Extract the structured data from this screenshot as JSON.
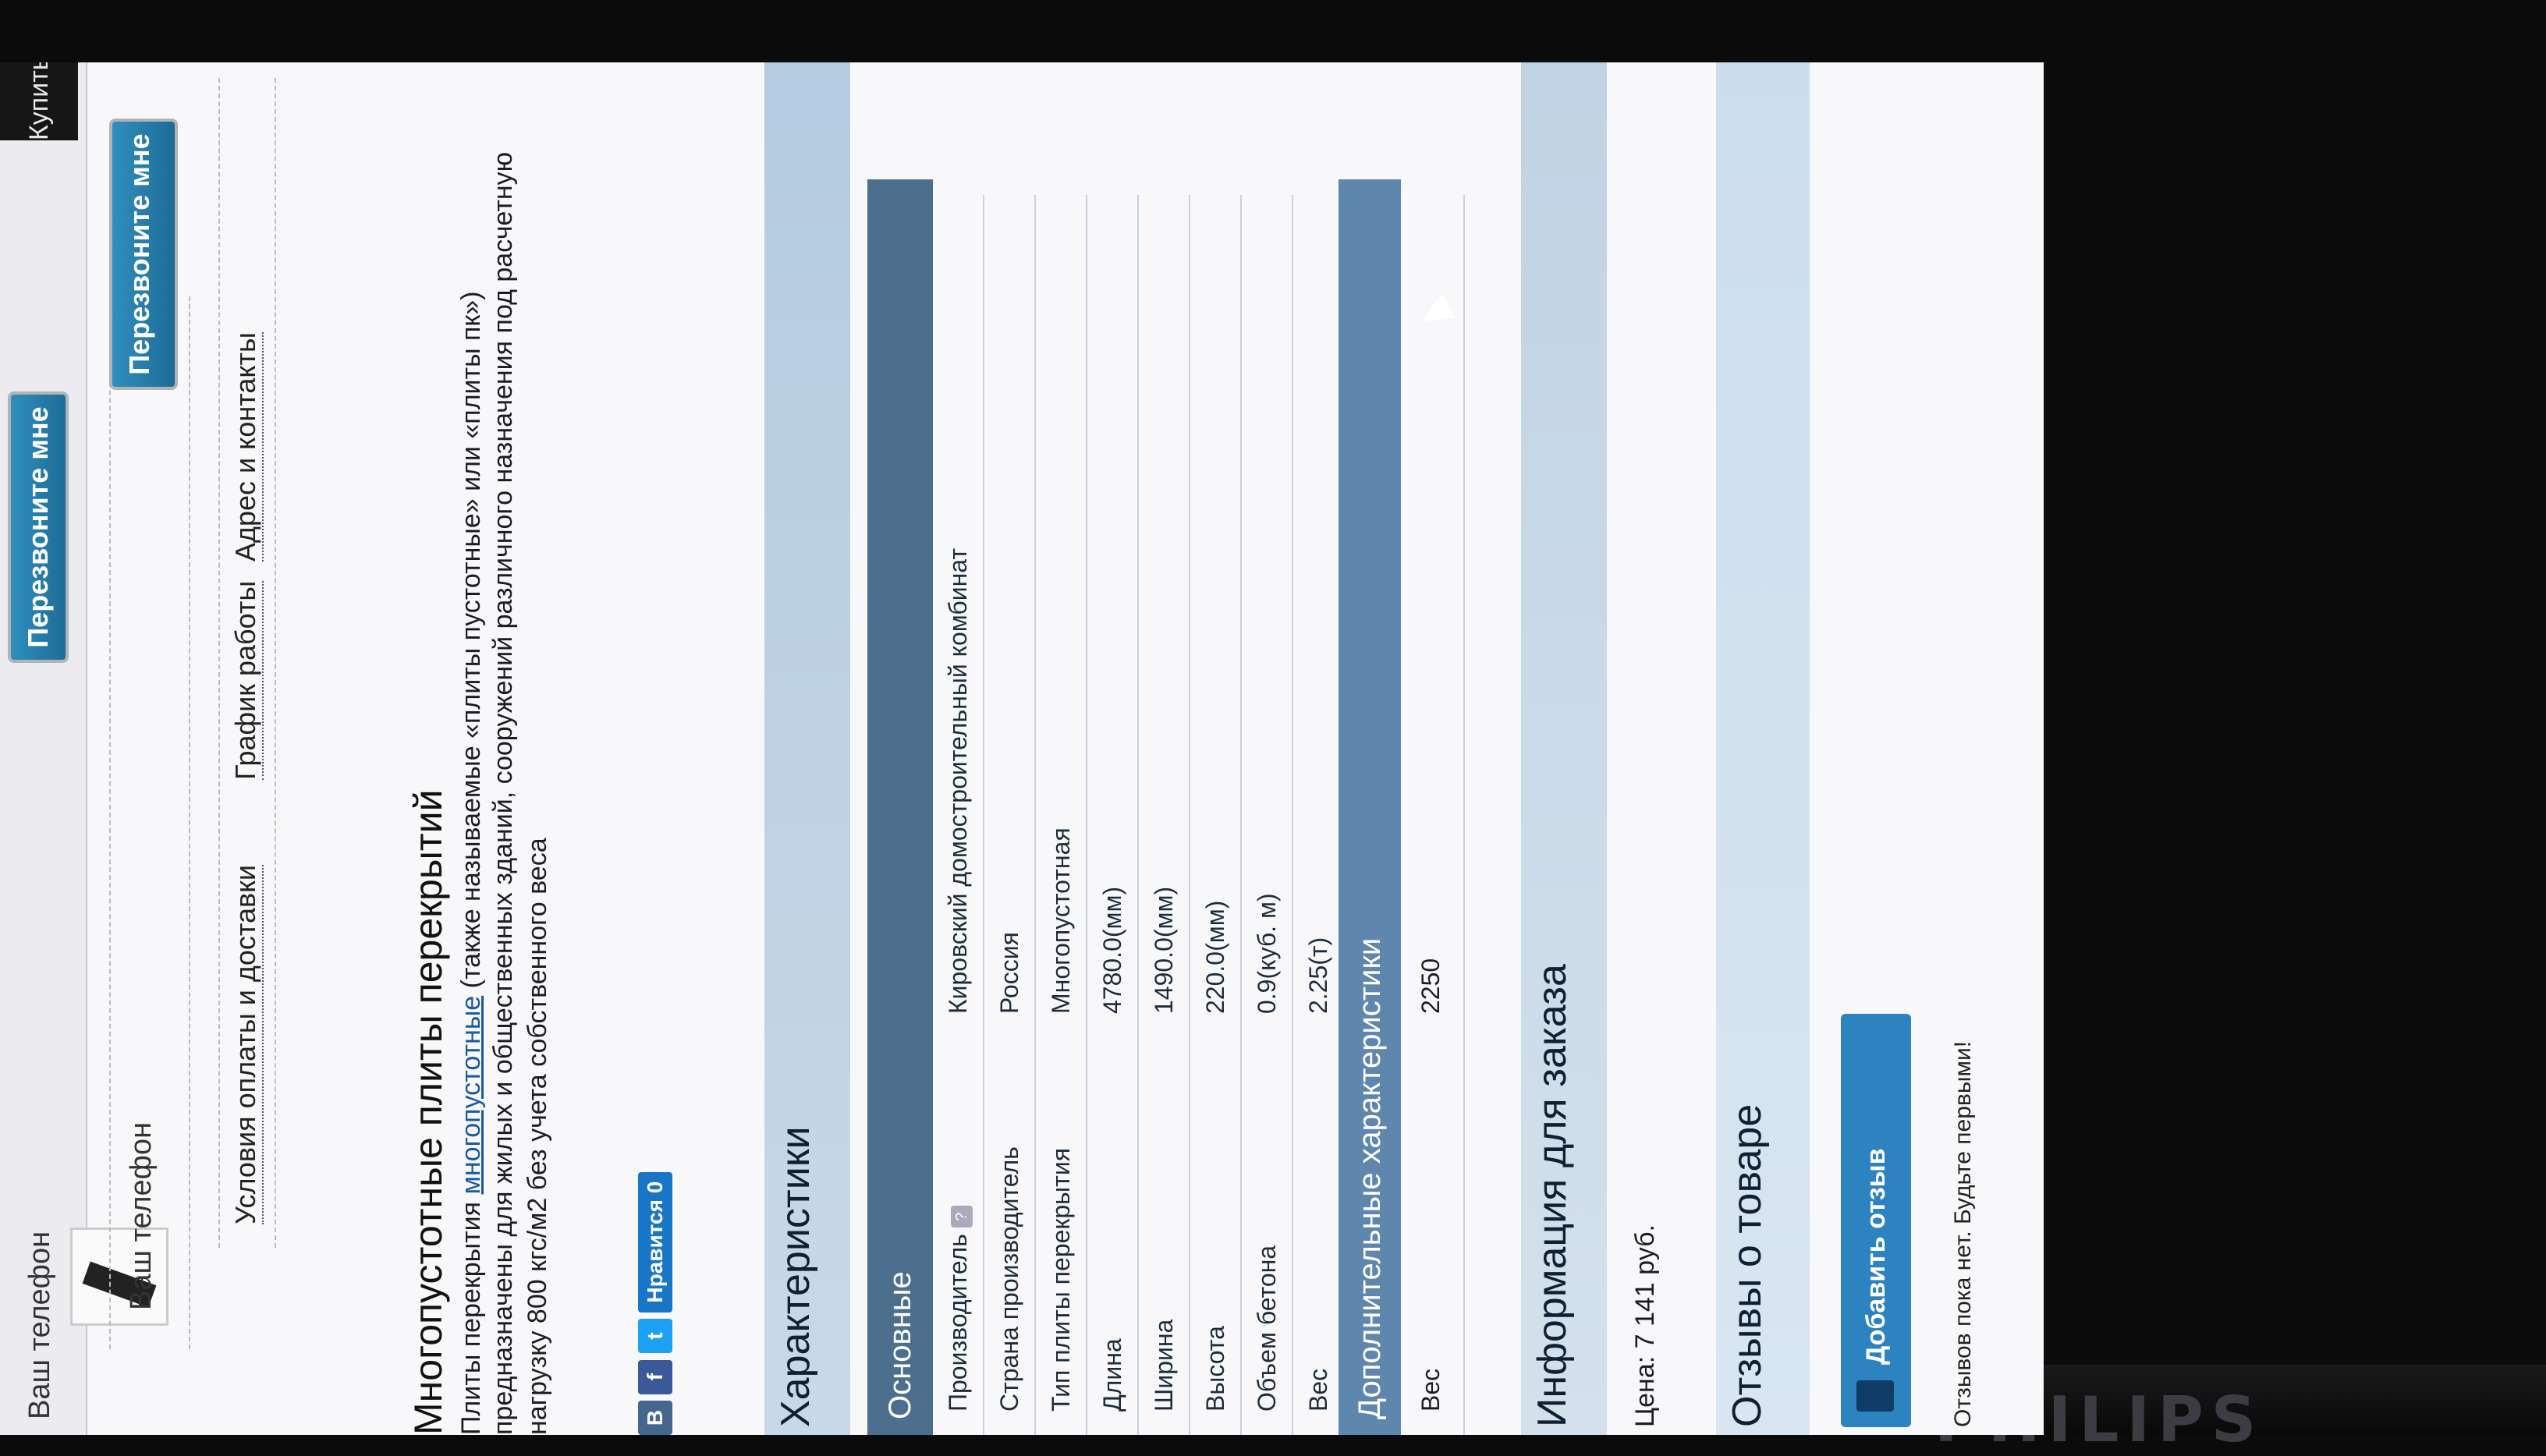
{
  "header": {
    "phone_label_top": "Ваш телефон",
    "call_button_top": "Перезвоните мне",
    "buy_button": "Купить"
  },
  "form": {
    "phone_label": "Ваш телефон",
    "call_button": "Перезвоните мне"
  },
  "links": [
    "Условия оплаты и доставки",
    "График работы",
    "Адрес и контакты"
  ],
  "product": {
    "title": "Многопустотные плиты перекрытий",
    "desc_prefix": "Плиты перекрытия ",
    "desc_link": "многопустотные",
    "desc_rest1": " (также называемые «плиты пустотные» или «плиты пк»)",
    "desc_line2": "предназначены для жилых и общественных зданий, сооружений различного назначения под расчетную",
    "desc_line3": "нагрузку 800 кгс/м2 без учета собственного веса"
  },
  "social": {
    "vk": "В",
    "fb": "f",
    "tw": "t",
    "like": "Нравится 0"
  },
  "characteristics": {
    "title": "Характеристики",
    "basic_header": "Основные",
    "rows": [
      {
        "label": "Производитель",
        "value": "Кировский домостроительный комбинат"
      },
      {
        "label": "Страна производитель",
        "value": "Россия"
      },
      {
        "label": "Тип плиты перекрытия",
        "value": "Многопустотная"
      },
      {
        "label": "Длина",
        "value": "4780.0(мм)"
      },
      {
        "label": "Ширина",
        "value": "1490.0(мм)"
      },
      {
        "label": "Высота",
        "value": "220.0(мм)"
      },
      {
        "label": "Объем бетона",
        "value": "0.9(куб. м)"
      },
      {
        "label": "Вес",
        "value": "2.25(т)"
      }
    ],
    "extra_header": "Дополнительные характеристики",
    "extra_row": {
      "label": "Вес",
      "value": "2250"
    }
  },
  "order": {
    "title": "Информация для заказа",
    "price": "Цена: 7 141 руб."
  },
  "reviews": {
    "title": "Отзывы о товаре",
    "add_button": "Добавить отзыв",
    "empty_text": "Отзывов пока нет. Будьте первыми!"
  },
  "monitor": {
    "brand": "PHILIPS"
  },
  "colors": {
    "section_header": "#4c6f8e",
    "button_blue": "#2d83c0",
    "link_blue": "#1b58a0"
  }
}
